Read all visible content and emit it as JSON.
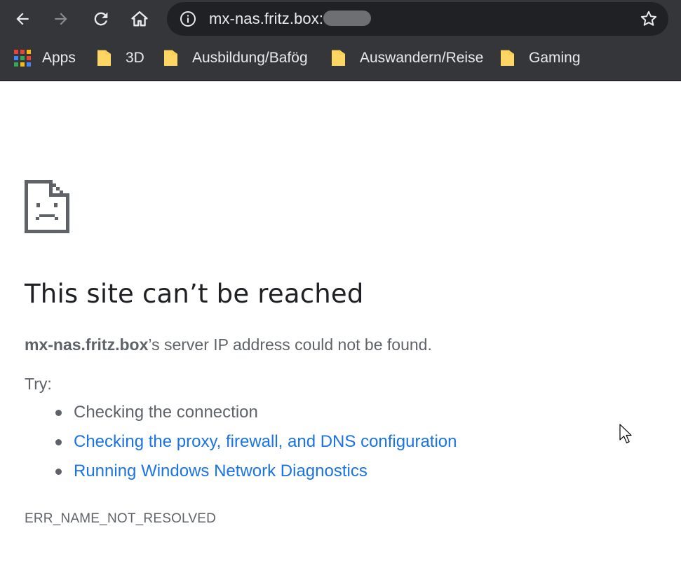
{
  "toolbar": {
    "back_icon": "arrow-left-icon",
    "forward_icon": "arrow-right-icon",
    "reload_icon": "reload-icon",
    "home_icon": "home-icon",
    "info_icon": "info-icon",
    "url": "mx-nas.fritz.box:",
    "url_redacted": true,
    "star_icon": "star-outline-icon"
  },
  "bookmarks": {
    "apps_label": "Apps",
    "items": [
      {
        "label": "3D",
        "icon": "folder-icon"
      },
      {
        "label": "Ausbildung/Bafög",
        "icon": "folder-icon"
      },
      {
        "label": "Auswandern/Reise",
        "icon": "folder-icon"
      },
      {
        "label": "Gaming",
        "icon": "folder-icon"
      }
    ]
  },
  "error_page": {
    "icon": "sad-page-icon",
    "heading": "This site can’t be reached",
    "host": "mx-nas.fritz.box",
    "summary_rest": "’s server IP address could not be found.",
    "try_label": "Try:",
    "suggestions": [
      {
        "text": "Checking the connection",
        "link": false
      },
      {
        "text": "Checking the proxy, firewall, and DNS configuration",
        "link": true
      },
      {
        "text": "Running Windows Network Diagnostics",
        "link": true
      }
    ],
    "error_code": "ERR_NAME_NOT_RESOLVED"
  },
  "colors": {
    "chrome_bg": "#35363a",
    "omnibox_bg": "#202124",
    "link": "#1a73e8",
    "body_text": "#5f6368",
    "heading_text": "#202124",
    "folder": "#fdd663"
  }
}
